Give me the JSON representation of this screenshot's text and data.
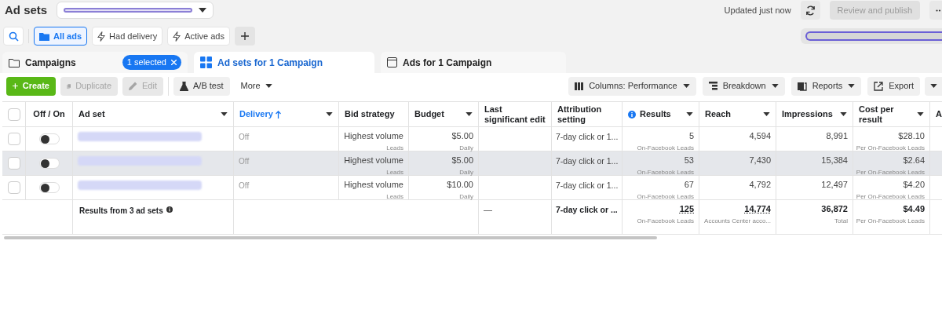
{
  "header": {
    "title": "Ad sets",
    "status": "Updated just now",
    "publish_button": {
      "label": "Review and publish",
      "disabled": true
    }
  },
  "filters": [
    {
      "kind": "folder",
      "label": "All ads",
      "selected": true
    },
    {
      "kind": "bolt",
      "label": "Had delivery",
      "selected": false
    },
    {
      "kind": "bolt",
      "label": "Active ads",
      "selected": false
    }
  ],
  "tabs": [
    {
      "kind": "campaigns",
      "label": "Campaigns",
      "badge": "1 selected",
      "selected": false
    },
    {
      "kind": "adsets",
      "label": "Ad sets for 1 Campaign",
      "selected": true
    },
    {
      "kind": "ads",
      "label": "Ads for 1 Campaign",
      "selected": false
    }
  ],
  "toolbar_left": [
    {
      "kind": "create",
      "label": "Create",
      "disabled": false
    },
    {
      "kind": "duplicate",
      "label": "Duplicate",
      "disabled": true
    },
    {
      "kind": "edit",
      "label": "Edit",
      "disabled": true
    },
    {
      "kind": "abtest",
      "label": "A/B test",
      "disabled": false
    },
    {
      "kind": "more",
      "label": "More",
      "disabled": false
    }
  ],
  "toolbar_right": [
    {
      "kind": "columns",
      "label": "Columns: Performance"
    },
    {
      "kind": "breakdown",
      "label": "Breakdown"
    },
    {
      "kind": "reports",
      "label": "Reports"
    },
    {
      "kind": "export",
      "label": "Export"
    }
  ],
  "table": {
    "all_checked": false,
    "columns": [
      {
        "label": "Off / On",
        "menu": false,
        "sorted": false,
        "info": false
      },
      {
        "label": "Ad set",
        "menu": true,
        "sorted": false,
        "info": false
      },
      {
        "label": "Delivery",
        "menu": true,
        "sorted": true,
        "info": false
      },
      {
        "label": "Bid strategy",
        "menu": false,
        "sorted": false,
        "info": false
      },
      {
        "label": "Budget",
        "menu": true,
        "sorted": false,
        "info": false
      },
      {
        "label": "Last significant edit",
        "menu": false,
        "sorted": false,
        "info": false
      },
      {
        "label": "Attribution setting",
        "menu": false,
        "sorted": false,
        "info": false
      },
      {
        "label": "Results",
        "menu": true,
        "sorted": false,
        "info": true
      },
      {
        "label": "Reach",
        "menu": true,
        "sorted": false,
        "info": false
      },
      {
        "label": "Impressions",
        "menu": true,
        "sorted": false,
        "info": false
      },
      {
        "label": "Cost per result",
        "menu": true,
        "sorted": false,
        "info": false
      },
      {
        "label": "A"
      }
    ],
    "rows": [
      {
        "checked": false,
        "on": false,
        "highlighted": false,
        "delivery": "Off",
        "bid": "Highest volume",
        "bid_sub": "Leads",
        "budget": "$5.00",
        "budget_sub": "Daily",
        "attribution": "7-day click or 1...",
        "results": "5",
        "results_sub": "On-Facebook Leads",
        "reach": "4,594",
        "impressions": "8,991",
        "cost": "$28.10",
        "cost_sub": "Per On-Facebook Leads"
      },
      {
        "checked": false,
        "on": false,
        "highlighted": true,
        "delivery": "Off",
        "bid": "Highest volume",
        "bid_sub": "Leads",
        "budget": "$5.00",
        "budget_sub": "Daily",
        "attribution": "7-day click or 1...",
        "results": "53",
        "results_sub": "On-Facebook Leads",
        "reach": "7,430",
        "impressions": "15,384",
        "cost": "$2.64",
        "cost_sub": "Per On-Facebook Leads"
      },
      {
        "checked": false,
        "on": false,
        "highlighted": false,
        "delivery": "Off",
        "bid": "Highest volume",
        "bid_sub": "Leads",
        "budget": "$10.00",
        "budget_sub": "Daily",
        "attribution": "7-day click or 1...",
        "results": "67",
        "results_sub": "On-Facebook Leads",
        "reach": "4,792",
        "impressions": "12,497",
        "cost": "$4.20",
        "cost_sub": "Per On-Facebook Leads"
      }
    ],
    "summary": {
      "label": "Results from 3 ad sets",
      "last_edit": "—",
      "attribution": "7-day click or ...",
      "results": "125",
      "results_sub": "On-Facebook Leads",
      "reach": "14,774",
      "reach_sub": "Accounts Center acco...",
      "impressions": "36,872",
      "impressions_sub": "Total",
      "cost": "$4.49",
      "cost_sub": "Per On-Facebook Leads"
    }
  }
}
